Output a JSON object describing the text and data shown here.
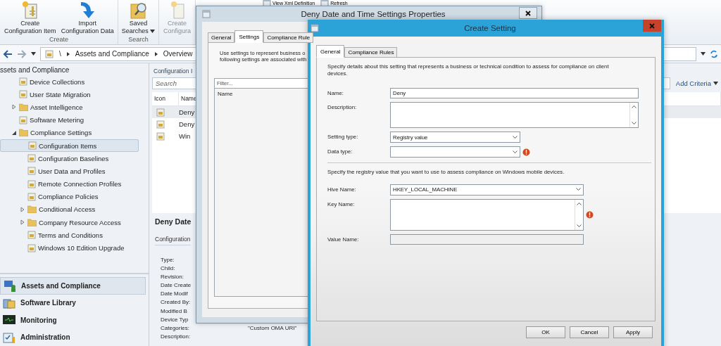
{
  "ribbon": {
    "groups": [
      {
        "label": "Create",
        "buttons": [
          {
            "label": "Create Configuration Item",
            "disabled": false,
            "dropdown": false
          },
          {
            "label": "Import Configuration Data",
            "disabled": false,
            "dropdown": false
          }
        ]
      },
      {
        "label": "Search",
        "buttons": [
          {
            "label": "Saved Searches",
            "disabled": false,
            "dropdown": true
          }
        ]
      },
      {
        "buttons": [
          {
            "label": "Create Configura",
            "disabled": true,
            "dropdown": false
          }
        ]
      }
    ],
    "small_buttons": [
      "View Xml Definition",
      "Refresh"
    ]
  },
  "address_bar": {
    "path": [
      "\\",
      "Assets and Compliance",
      "Overview"
    ]
  },
  "navigation": {
    "title": "ssets and Compliance",
    "tree": [
      {
        "label": "Device Collections",
        "kind": "item",
        "selected": false
      },
      {
        "label": "User State Migration",
        "kind": "item",
        "selected": false
      },
      {
        "label": "Asset Intelligence",
        "kind": "group",
        "expanded": false,
        "selected": false
      },
      {
        "label": "Software Metering",
        "kind": "item",
        "selected": false
      },
      {
        "label": "Compliance Settings",
        "kind": "group",
        "expanded": true,
        "selected": false,
        "children": [
          {
            "label": "Configuration Items",
            "kind": "item",
            "selected": true
          },
          {
            "label": "Configuration Baselines",
            "kind": "item",
            "selected": false
          },
          {
            "label": "User Data and Profiles",
            "kind": "item",
            "selected": false
          },
          {
            "label": "Remote Connection Profiles",
            "kind": "item",
            "selected": false
          },
          {
            "label": "Compliance Policies",
            "kind": "item",
            "selected": false
          },
          {
            "label": "Conditional Access",
            "kind": "group",
            "expanded": false,
            "selected": false
          },
          {
            "label": "Company Resource Access",
            "kind": "group",
            "expanded": false,
            "selected": false
          },
          {
            "label": "Terms and Conditions",
            "kind": "item",
            "selected": false
          },
          {
            "label": "Windows 10 Edition Upgrade",
            "kind": "item",
            "selected": false
          }
        ]
      }
    ]
  },
  "workspaces": [
    {
      "label": "Assets and Compliance",
      "selected": true
    },
    {
      "label": "Software Library",
      "selected": false
    },
    {
      "label": "Monitoring",
      "selected": false
    },
    {
      "label": "Administration",
      "selected": false
    }
  ],
  "content": {
    "title": "Configuration I",
    "search": {
      "placeholder": "Search"
    },
    "add_criteria": "Add Criteria",
    "columns": [
      "Icon",
      "Name"
    ],
    "rows": [
      {
        "name": "Deny",
        "selected": true
      },
      {
        "name": "Deny",
        "selected": false
      },
      {
        "name": "Win",
        "selected": false
      }
    ],
    "details": {
      "title": "Deny Date",
      "section": "Configuration",
      "fields": [
        {
          "label": "Type:"
        },
        {
          "label": "Child:"
        },
        {
          "label": "Revision:"
        },
        {
          "label": "Date Create"
        },
        {
          "label": "Date Modif"
        },
        {
          "label": "Created By:"
        },
        {
          "label": "Modified B"
        },
        {
          "label": "Device Typ"
        },
        {
          "label": "Categories:",
          "value": "\"Custom OMA URI\""
        },
        {
          "label": "Description:"
        }
      ]
    }
  },
  "properties_dialog": {
    "title": "Deny Date and Time Settings Properties",
    "tabs": [
      {
        "label": "General",
        "selected": false
      },
      {
        "label": "Settings",
        "selected": true
      },
      {
        "label": "Compliance Rule",
        "selected": false
      }
    ],
    "intro": [
      "Use settings to represent business o",
      "following settings are associated with"
    ],
    "filter": {
      "placeholder": "Filter..."
    },
    "columns": [
      "Name"
    ]
  },
  "create_dialog": {
    "title": "Create Setting",
    "tabs": [
      {
        "label": "General",
        "selected": true
      },
      {
        "label": "Compliance Rules",
        "selected": false
      }
    ],
    "intro": "Specify details about this setting that represents a business or technical condition to assess for compliance on client devices.",
    "fields": [
      {
        "label": "Name:",
        "kind": "text",
        "value": "Deny",
        "error": false,
        "disabled": false
      },
      {
        "label": "Description:",
        "kind": "textarea",
        "error": false,
        "disabled": false
      },
      {
        "label": "Setting type:",
        "kind": "select",
        "value": "Registry value",
        "error": false,
        "disabled": false
      },
      {
        "label": "Data type:",
        "kind": "select",
        "error": true,
        "disabled": false
      }
    ],
    "registry_intro": "Specify the registry value that you want to use to assess compliance on Windows mobile devices.",
    "registry_fields": [
      {
        "label": "Hive Name:",
        "kind": "select",
        "value": "HKEY_LOCAL_MACHINE",
        "error": false,
        "disabled": false
      },
      {
        "label": "Key Name:",
        "kind": "textarea",
        "error": true,
        "disabled": false
      },
      {
        "label": "Value Name:",
        "kind": "text",
        "error": false,
        "disabled": true
      }
    ],
    "buttons": [
      "OK",
      "Cancel",
      "Apply"
    ]
  }
}
